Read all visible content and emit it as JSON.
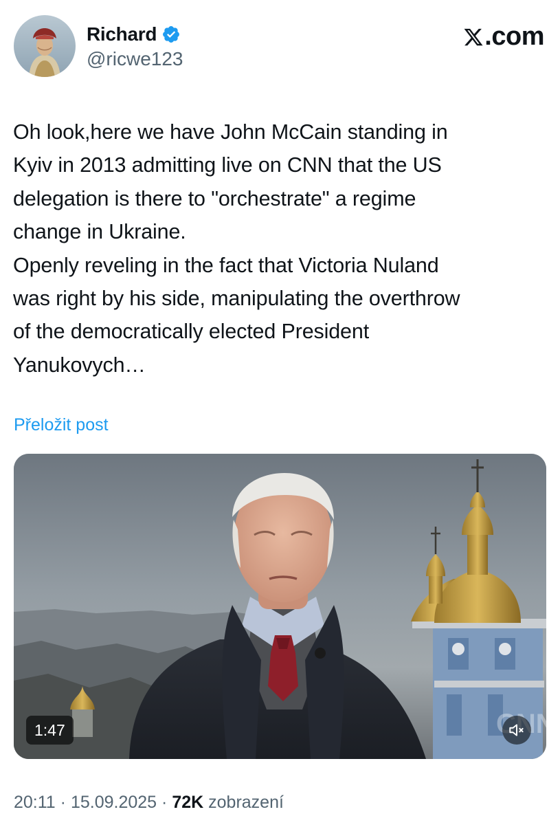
{
  "author": {
    "name": "Richard",
    "handle": "@ricwe123",
    "verified": true,
    "avatar_icon": "portrait-avatar"
  },
  "brand": {
    "label": ".com",
    "icon": "x-logo-icon"
  },
  "tweet": {
    "lines": [
      "Oh look,here we have John McCain standing in",
      "Kyiv in 2013 admitting live on CNN that the US",
      "delegation is there to \"orchestrate\" a regime",
      "change in Ukraine.",
      "Openly reveling in the fact that Victoria Nuland",
      "was right by his side, manipulating the overthrow",
      "of the democratically elected President",
      "Yanukovych…"
    ]
  },
  "translate_label": "Přeložit post",
  "video": {
    "duration": "1:47",
    "mute_icon": "speaker-muted-icon",
    "watermark": "CNN"
  },
  "meta": {
    "time": "20:11",
    "separator": "·",
    "date": "15.09.2025",
    "views_count": "72K",
    "views_label": "zobrazení"
  },
  "colors": {
    "link": "#1d9bf0",
    "verified": "#1d9bf0",
    "text": "#0f1419",
    "secondary": "#536471"
  }
}
